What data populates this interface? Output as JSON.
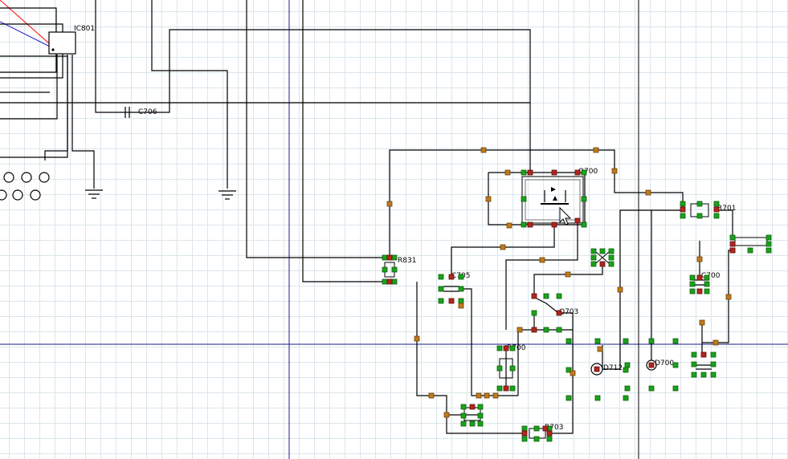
{
  "app": {
    "view": "pcb-schematic-canvas"
  },
  "colors": {
    "wire": "#000000",
    "pad_ok": "#1aa31a",
    "pad_conn": "#b3261e",
    "junction": "#c07a1c",
    "crosshair": "#1b1b8a",
    "grid": "#dbe6ec",
    "ratsnest_red": "#ff0000",
    "ratsnest_blue": "#2020d0"
  },
  "components": {
    "ic801": "IC801",
    "c706": "C706",
    "q700": "Q700",
    "r831": "R831",
    "c705": "C705",
    "q703": "Q703",
    "r700": "R700",
    "r703": "R703",
    "r701": "R701",
    "c700": "C700",
    "d712": "D712",
    "d700": "D700"
  },
  "cursor": {
    "icon": "arrow-pointer-icon"
  }
}
